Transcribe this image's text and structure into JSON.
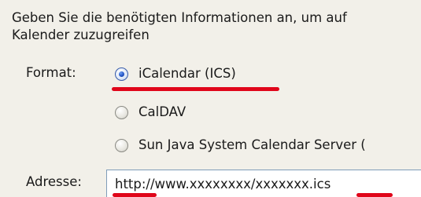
{
  "dialog": {
    "intro_line1": "Geben Sie die benötigten Informationen an, um auf",
    "intro_line2": "Kalender zuzugreifen"
  },
  "format": {
    "label": "Format:",
    "options": [
      {
        "label": "iCalendar (ICS)",
        "selected": true
      },
      {
        "label": "CalDAV",
        "selected": false
      },
      {
        "label": "Sun Java System Calendar Server (",
        "selected": false
      }
    ]
  },
  "address": {
    "label": "Adresse:",
    "value": "http://www.xxxxxxxx/xxxxxxx.ics"
  },
  "colors": {
    "annotation_red": "#e0061a",
    "radio_selected": "#2455c8",
    "background": "#f2f0e9"
  }
}
